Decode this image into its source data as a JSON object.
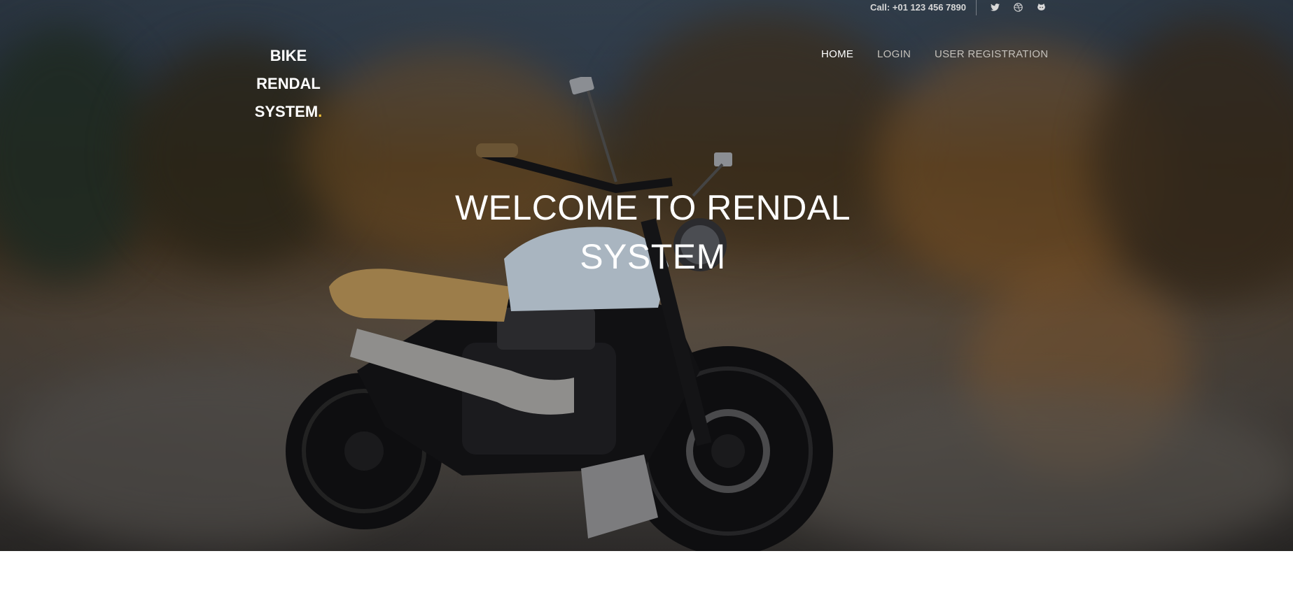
{
  "topbar": {
    "phone": "Call: +01 123 456 7890",
    "social_icons": [
      "twitter-icon",
      "dribbble-icon",
      "github-icon"
    ]
  },
  "brand": {
    "line1": "BIKE",
    "line2": "RENDAL",
    "line3": "SYSTEM",
    "dot": ".",
    "accent_color": "#f3c33b"
  },
  "nav": {
    "items": [
      {
        "label": "HOME",
        "active": true
      },
      {
        "label": "LOGIN",
        "active": false
      },
      {
        "label": "USER REGISTRATION",
        "active": false
      }
    ]
  },
  "hero": {
    "title": "WELCOME TO RENDAL SYSTEM",
    "background_image": "motorcycle"
  }
}
